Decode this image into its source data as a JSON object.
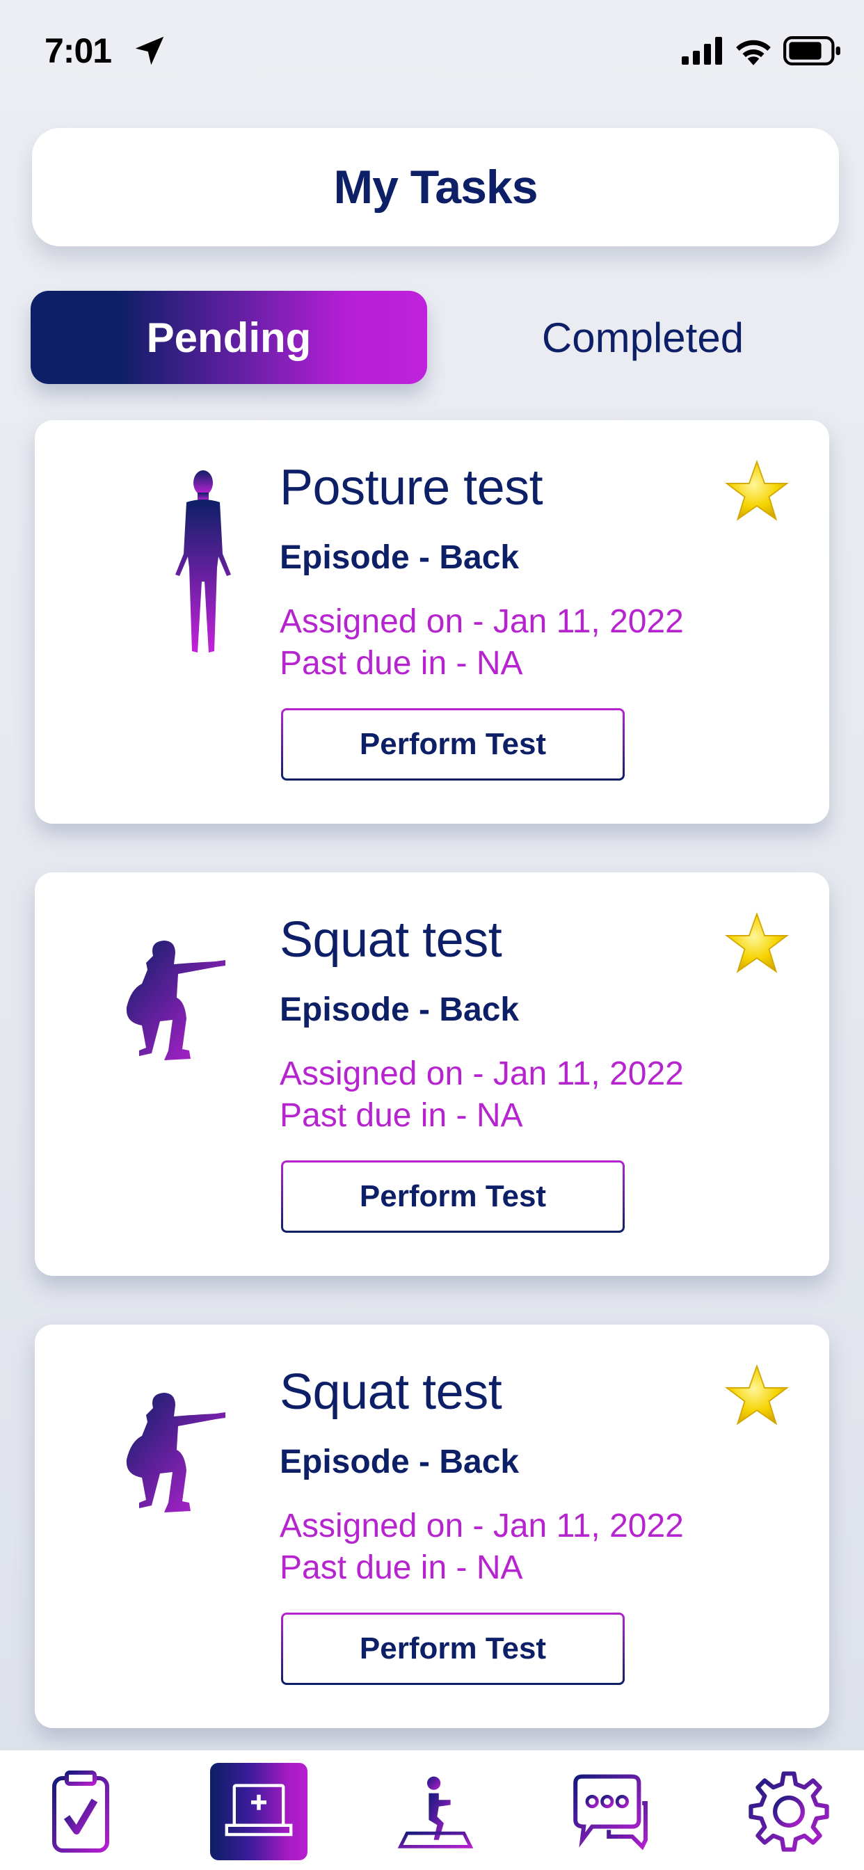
{
  "status_bar": {
    "time": "7:01",
    "icons": [
      "location-arrow-icon",
      "cellular-signal-icon",
      "wifi-icon",
      "battery-icon"
    ]
  },
  "header": {
    "title": "My Tasks"
  },
  "tabs": [
    {
      "label": "Pending",
      "active": true
    },
    {
      "label": "Completed",
      "active": false
    }
  ],
  "tasks": [
    {
      "title": "Posture test",
      "episode": "Episode - Back",
      "assigned": "Assigned on - Jan 11, 2022",
      "due": "Past due in - NA",
      "button": "Perform Test",
      "figure": "standing-person-icon",
      "starred": true
    },
    {
      "title": "Squat test",
      "episode": "Episode - Back",
      "assigned": "Assigned on - Jan 11, 2022",
      "due": "Past due in - NA",
      "button": "Perform Test",
      "figure": "squatting-person-icon",
      "starred": true
    },
    {
      "title": "Squat test",
      "episode": "Episode - Back",
      "assigned": "Assigned on - Jan 11, 2022",
      "due": "Past due in - NA",
      "button": "Perform Test",
      "figure": "squatting-person-icon",
      "starred": true
    }
  ],
  "bottom_nav": [
    {
      "name": "tasks",
      "icon": "clipboard-check-icon",
      "active": false
    },
    {
      "name": "telehealth",
      "icon": "laptop-plus-icon",
      "active": true
    },
    {
      "name": "exercise",
      "icon": "squat-mat-icon",
      "active": false
    },
    {
      "name": "messages",
      "icon": "chat-bubbles-icon",
      "active": false
    },
    {
      "name": "settings",
      "icon": "gear-icon",
      "active": false
    }
  ],
  "colors": {
    "navy": "#0d1f66",
    "magenta": "#b624cf",
    "star": "#f2c600",
    "background": "#e8ebf1"
  }
}
